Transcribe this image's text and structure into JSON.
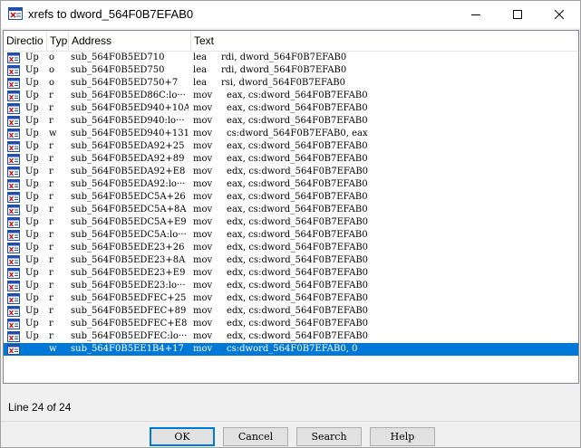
{
  "window": {
    "title": "xrefs to dword_564F0B7EFAB0"
  },
  "columns": [
    "Directio",
    "Typ",
    "Address",
    "Text"
  ],
  "rows": [
    {
      "dir": "Up",
      "type": "o",
      "address": "sub_564F0B5ED710",
      "text": "lea     rdi, dword_564F0B7EFAB0"
    },
    {
      "dir": "Up",
      "type": "o",
      "address": "sub_564F0B5ED750",
      "text": "lea     rdi, dword_564F0B7EFAB0"
    },
    {
      "dir": "Up",
      "type": "o",
      "address": "sub_564F0B5ED750+7",
      "text": "lea     rsi, dword_564F0B7EFAB0"
    },
    {
      "dir": "Up",
      "type": "r",
      "address": "sub_564F0B5ED86C:lo···",
      "text": "mov     eax, cs:dword_564F0B7EFAB0"
    },
    {
      "dir": "Up",
      "type": "r",
      "address": "sub_564F0B5ED940+10A",
      "text": "mov     eax, cs:dword_564F0B7EFAB0"
    },
    {
      "dir": "Up",
      "type": "r",
      "address": "sub_564F0B5ED940:lo···",
      "text": "mov     eax, cs:dword_564F0B7EFAB0"
    },
    {
      "dir": "Up",
      "type": "w",
      "address": "sub_564F0B5ED940+131",
      "text": "mov     cs:dword_564F0B7EFAB0, eax"
    },
    {
      "dir": "Up",
      "type": "r",
      "address": "sub_564F0B5EDA92+25",
      "text": "mov     eax, cs:dword_564F0B7EFAB0"
    },
    {
      "dir": "Up",
      "type": "r",
      "address": "sub_564F0B5EDA92+89",
      "text": "mov     eax, cs:dword_564F0B7EFAB0"
    },
    {
      "dir": "Up",
      "type": "r",
      "address": "sub_564F0B5EDA92+E8",
      "text": "mov     edx, cs:dword_564F0B7EFAB0"
    },
    {
      "dir": "Up",
      "type": "r",
      "address": "sub_564F0B5EDA92:lo···",
      "text": "mov     eax, cs:dword_564F0B7EFAB0"
    },
    {
      "dir": "Up",
      "type": "r",
      "address": "sub_564F0B5EDC5A+26",
      "text": "mov     eax, cs:dword_564F0B7EFAB0"
    },
    {
      "dir": "Up",
      "type": "r",
      "address": "sub_564F0B5EDC5A+8A",
      "text": "mov     eax, cs:dword_564F0B7EFAB0"
    },
    {
      "dir": "Up",
      "type": "r",
      "address": "sub_564F0B5EDC5A+E9",
      "text": "mov     edx, cs:dword_564F0B7EFAB0"
    },
    {
      "dir": "Up",
      "type": "r",
      "address": "sub_564F0B5EDC5A:lo···",
      "text": "mov     eax, cs:dword_564F0B7EFAB0"
    },
    {
      "dir": "Up",
      "type": "r",
      "address": "sub_564F0B5EDE23+26",
      "text": "mov     edx, cs:dword_564F0B7EFAB0"
    },
    {
      "dir": "Up",
      "type": "r",
      "address": "sub_564F0B5EDE23+8A",
      "text": "mov     edx, cs:dword_564F0B7EFAB0"
    },
    {
      "dir": "Up",
      "type": "r",
      "address": "sub_564F0B5EDE23+E9",
      "text": "mov     edx, cs:dword_564F0B7EFAB0"
    },
    {
      "dir": "Up",
      "type": "r",
      "address": "sub_564F0B5EDE23:lo···",
      "text": "mov     edx, cs:dword_564F0B7EFAB0"
    },
    {
      "dir": "Up",
      "type": "r",
      "address": "sub_564F0B5EDFEC+25",
      "text": "mov     edx, cs:dword_564F0B7EFAB0"
    },
    {
      "dir": "Up",
      "type": "r",
      "address": "sub_564F0B5EDFEC+89",
      "text": "mov     edx, cs:dword_564F0B7EFAB0"
    },
    {
      "dir": "Up",
      "type": "r",
      "address": "sub_564F0B5EDFEC+E8",
      "text": "mov     edx, cs:dword_564F0B7EFAB0"
    },
    {
      "dir": "Up",
      "type": "r",
      "address": "sub_564F0B5EDFEC:lo···",
      "text": "mov     edx, cs:dword_564F0B7EFAB0"
    },
    {
      "dir": "",
      "type": "w",
      "address": "sub_564F0B5EE1B4+17",
      "text": "mov     cs:dword_564F0B7EFAB0, 0",
      "selected": true
    }
  ],
  "status": "Line 24 of 24",
  "buttons": {
    "ok": "OK",
    "cancel": "Cancel",
    "search": "Search",
    "help": "Help"
  },
  "colors": {
    "selection": "#0078d7",
    "window_bg": "#f0f0f0",
    "list_bg": "#ffffff"
  },
  "icons": {
    "title": "xref-window-icon",
    "row": "xref-row-icon"
  }
}
